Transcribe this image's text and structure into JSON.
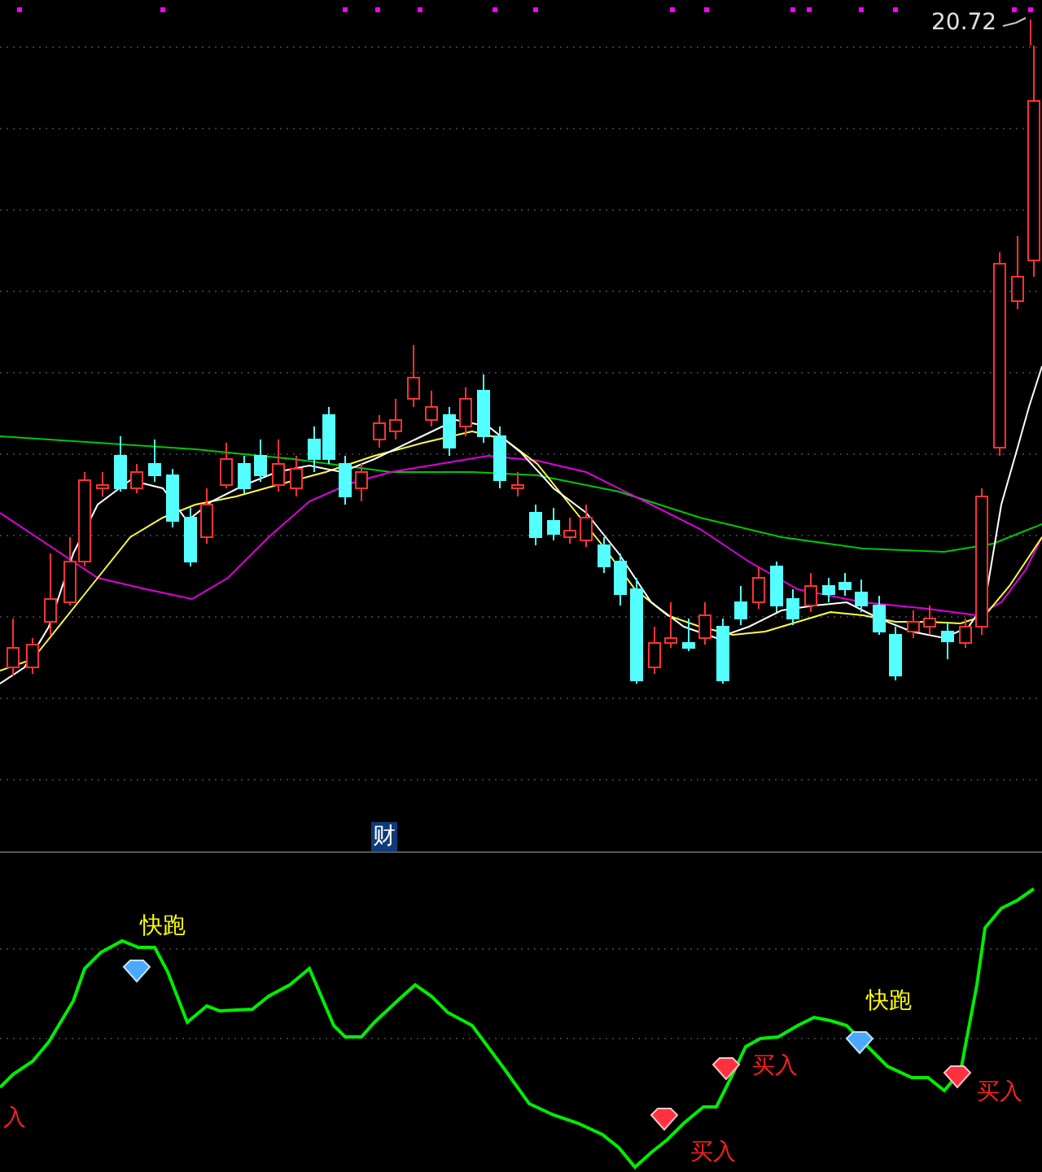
{
  "price_label": "20.72",
  "finance_marker": "财",
  "signals": [
    {
      "kind": "buy",
      "text": "入"
    },
    {
      "kind": "sell",
      "text": "快跑"
    },
    {
      "kind": "buy",
      "text": "买入"
    },
    {
      "kind": "buy",
      "text": "买入"
    },
    {
      "kind": "sell",
      "text": "快跑"
    },
    {
      "kind": "buy",
      "text": "买入"
    }
  ]
}
